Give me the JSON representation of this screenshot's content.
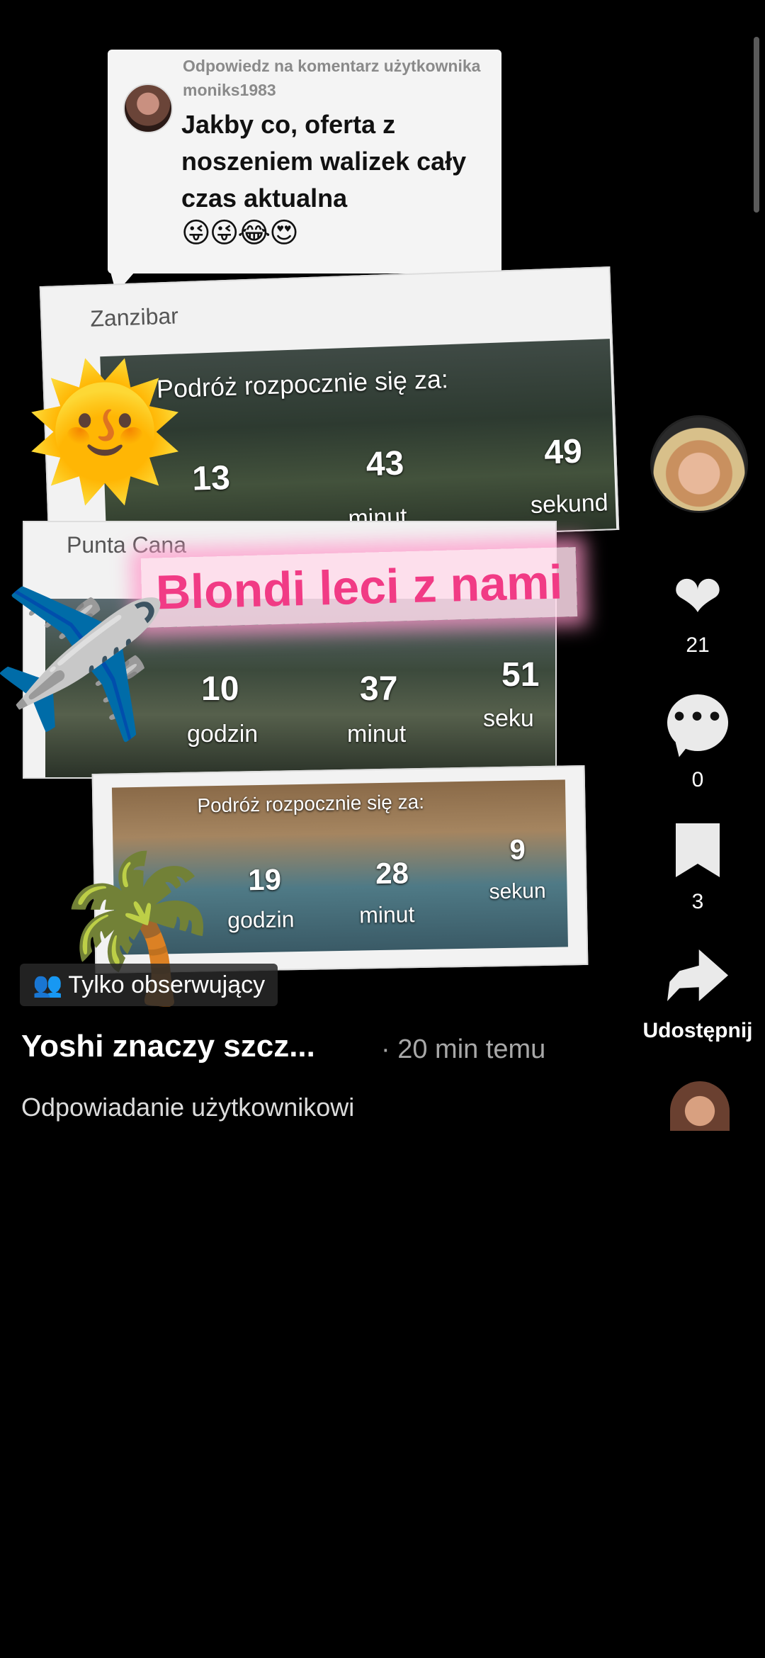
{
  "reply_comment": {
    "header": "Odpowiedz na komentarz użytkownika moniks1983",
    "text": "Jakby co, oferta z noszeniem walizek cały czas aktualna",
    "emojis": "😜😜😂😍"
  },
  "cards": [
    {
      "title": "Zanzibar",
      "heading": "Podróż rozpocznie się za:",
      "count1": "13",
      "count2": "43",
      "label2": "minut",
      "count3": "49",
      "label3": "sekund"
    },
    {
      "title": "Punta Cana",
      "count1": "10",
      "label1": "godzin",
      "count2": "37",
      "label2": "minut",
      "count3": "51",
      "label3": "seku"
    },
    {
      "heading": "Podróż rozpocznie się za:",
      "count1": "19",
      "label1": "godzin",
      "count2": "28",
      "label2": "minut",
      "count3": "9",
      "label3": "sekun"
    }
  ],
  "overlay_text": "Blondi leci z nami",
  "stickers": {
    "sun": "🌞",
    "plane": "✈️",
    "palm": "🌴"
  },
  "actions": {
    "likes": "21",
    "comments": "0",
    "saves": "3",
    "share_label": "Udostępnij"
  },
  "visibility_label": "Tylko obserwujący",
  "post_title": "Yoshi znaczy szcz...",
  "post_time": "· 20 min temu",
  "caption": "Odpowiadanie użytkownikowi",
  "icons": {
    "heart": "heart-icon",
    "comment": "comment-icon",
    "bookmark": "bookmark-icon",
    "share": "share-icon",
    "users": "users-icon"
  }
}
